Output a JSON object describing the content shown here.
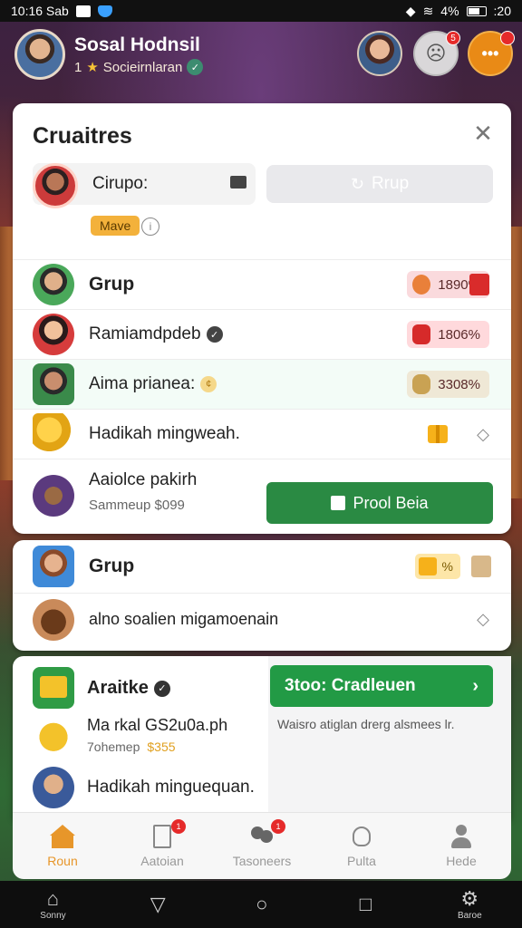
{
  "status_bar": {
    "time": "10:16 Sab",
    "battery": "4%",
    "right_time": ":20"
  },
  "profile": {
    "name": "Sosal Hodnsil",
    "level": "1",
    "subtitle": "Socieirnlaran"
  },
  "panel": {
    "title": "Cruaitres",
    "group_label": "Cirupo:",
    "join_label": "Rrup",
    "tag": "Mave",
    "rows": [
      {
        "label": "Grup",
        "value": "1890%",
        "pill_color": "#fadadd"
      },
      {
        "label": "Ramiamdpdeb",
        "value": "1806%",
        "pill_color": "#ffd9dc"
      },
      {
        "label": "Aima prianea:",
        "value": "3308%",
        "pill_color": "#efe8d6"
      },
      {
        "label": "Hadikah mingweah."
      },
      {
        "label": "Aaiolce pakirh",
        "sub": "Sammeup $099"
      }
    ],
    "claim_label": "Prool Beia"
  },
  "panel2": {
    "rows": [
      {
        "label": "Grup",
        "value": "%"
      },
      {
        "label": "alno soalien migamoenain"
      }
    ]
  },
  "panel3": {
    "rows": [
      {
        "label": "Araitke"
      },
      {
        "label": "Ma rkal GS2u0a.ph",
        "sub_left": "7ohemep",
        "sub_right": "$355"
      },
      {
        "label": "Hadikah minguequan."
      }
    ],
    "cta_label": "3too: Cradleuen",
    "desc": "Waisro atiglan drerg alsmees lr."
  },
  "nav": [
    {
      "label": "Roun",
      "active": true
    },
    {
      "label": "Aatoian",
      "badge": "1"
    },
    {
      "label": "Tasoneers",
      "badge": "1"
    },
    {
      "label": "Pulta"
    },
    {
      "label": "Hede"
    }
  ],
  "system_nav": {
    "home_label": "Sonny",
    "right_label": "Baroe"
  }
}
